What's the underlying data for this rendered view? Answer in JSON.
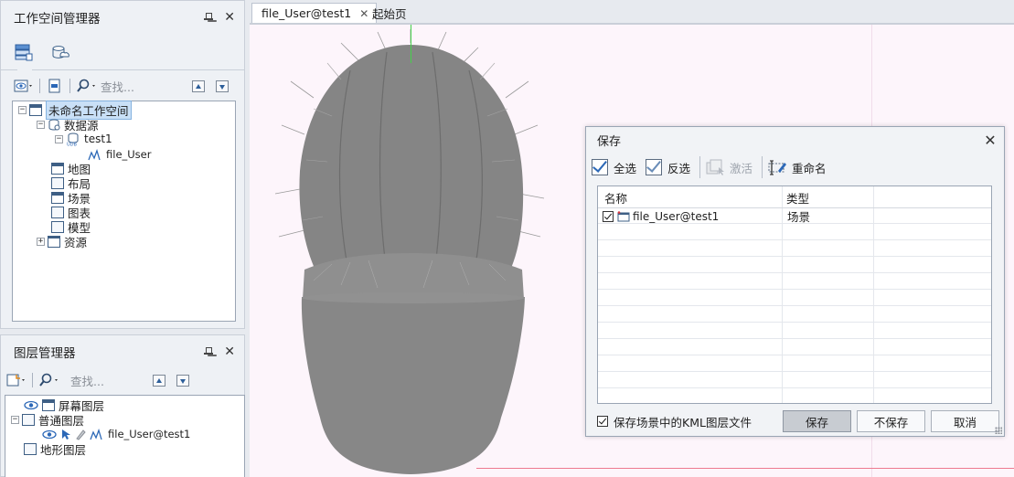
{
  "workspace_panel": {
    "title": "工作空间管理器",
    "search_placeholder": "查找...",
    "tree": {
      "root": "未命名工作空间",
      "datasources": "数据源",
      "datasource": "test1",
      "dataset": "file_User",
      "map": "地图",
      "layout": "布局",
      "scene": "场景",
      "chart": "图表",
      "model": "模型",
      "resources": "资源"
    }
  },
  "layer_panel": {
    "title": "图层管理器",
    "search_placeholder": "查找...",
    "tree": {
      "screen_layer": "屏幕图层",
      "normal_layer": "普通图层",
      "layer_item": "file_User@test1",
      "terrain_layer": "地形图层"
    }
  },
  "doc_tabs": [
    {
      "label": "file_User@test1",
      "active": true
    },
    {
      "label": "起始页",
      "active": false
    }
  ],
  "dialog": {
    "title": "保存",
    "toolbar": {
      "select_all": "全选",
      "invert": "反选",
      "activate": "激活",
      "rename": "重命名"
    },
    "columns": [
      "名称",
      "类型"
    ],
    "rows": [
      {
        "name": "file_User@test1",
        "type": "场景",
        "checked": true
      }
    ],
    "save_kml_label": "保存场景中的KML图层文件",
    "save_kml_checked": true,
    "buttons": {
      "save": "保存",
      "dont_save": "不保存",
      "cancel": "取消"
    }
  },
  "colors": {
    "scene_background": "#fdf5fb",
    "selection": "#c9e0f7",
    "model_gray": "#8c8c8c"
  }
}
